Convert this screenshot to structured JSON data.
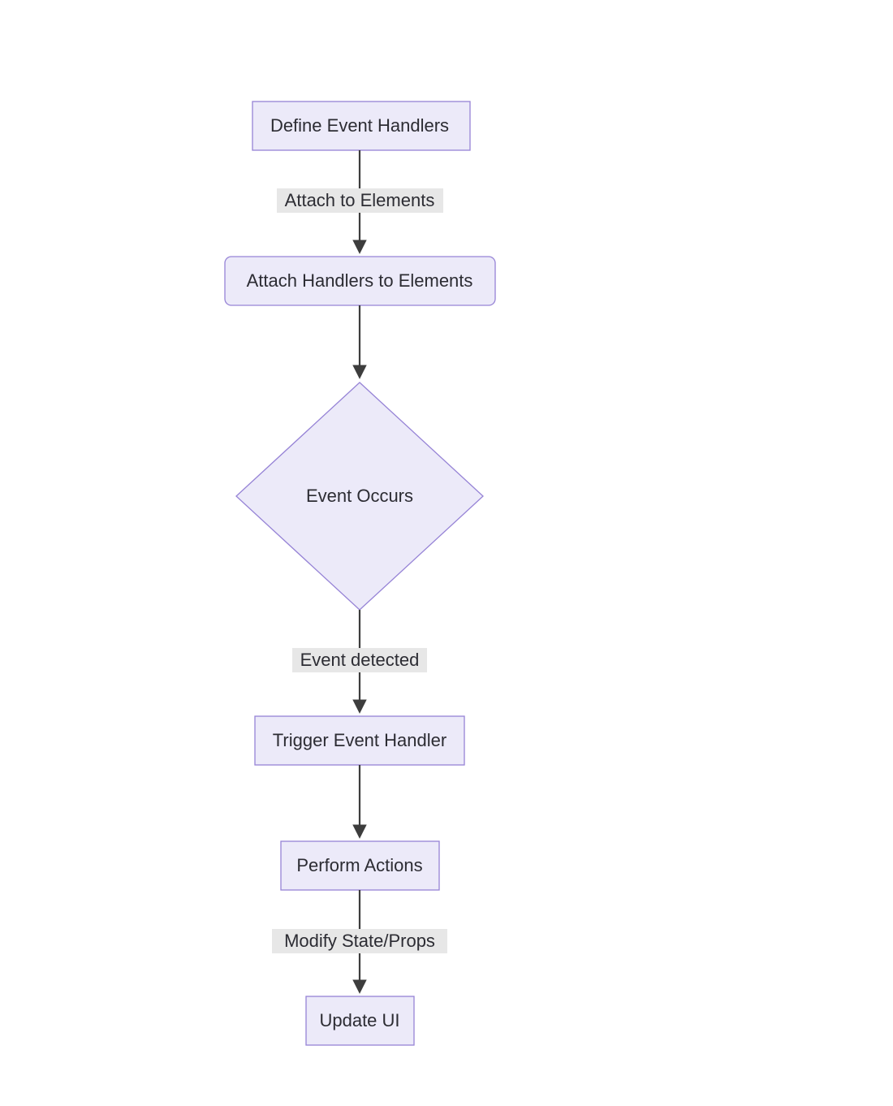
{
  "diagram": {
    "type": "flowchart",
    "direction": "TD",
    "nodes": {
      "define": {
        "label": "Define Event Handlers",
        "shape": "rect"
      },
      "attach": {
        "label": "Attach Handlers to Elements",
        "shape": "rounded"
      },
      "event": {
        "label": "Event Occurs",
        "shape": "diamond"
      },
      "trigger": {
        "label": "Trigger Event Handler",
        "shape": "rect"
      },
      "perform": {
        "label": "Perform Actions",
        "shape": "rect"
      },
      "update": {
        "label": "Update UI",
        "shape": "rect"
      }
    },
    "edges": {
      "e1": {
        "from": "define",
        "to": "attach",
        "label": "Attach to Elements"
      },
      "e2": {
        "from": "attach",
        "to": "event",
        "label": ""
      },
      "e3": {
        "from": "event",
        "to": "trigger",
        "label": "Event detected"
      },
      "e4": {
        "from": "trigger",
        "to": "perform",
        "label": ""
      },
      "e5": {
        "from": "perform",
        "to": "update",
        "label": "Modify State/Props"
      }
    },
    "colors": {
      "node_fill": "#eceaf9",
      "node_stroke": "#9683d6",
      "edge": "#3d3d3d",
      "label_bg": "#e7e7e7",
      "text": "#2c2c33"
    }
  }
}
